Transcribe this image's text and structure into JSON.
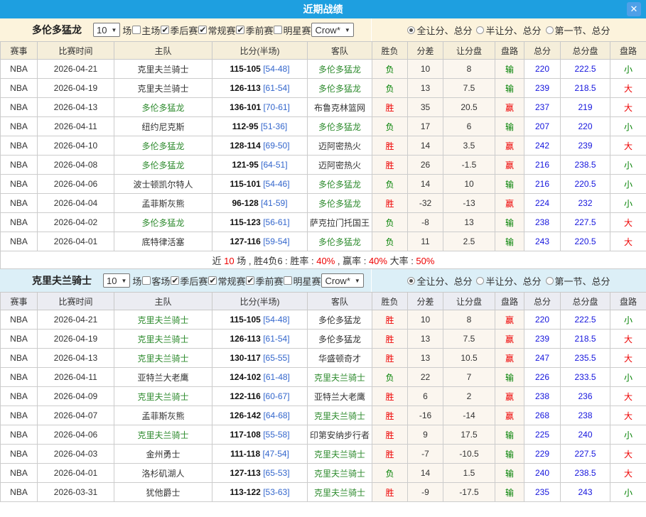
{
  "titlebar": {
    "title": "近期战绩"
  },
  "icons": {
    "close": "✕",
    "dropdown_arrow": "▼",
    "check": "✔"
  },
  "palette": {
    "titlebar_bg": "#1e9fe0",
    "close_bg": "#4fa0e8",
    "section1_bar_bg": "#fcf3dc",
    "section1_header_bg": "#f5eeda",
    "section2_bar_bg": "#dceff7",
    "section2_header_bg": "#ebecf2",
    "team_highlight_green": "#2e8b2e",
    "win_red": "#ee0000",
    "loss_green": "#008000",
    "total_blue": "#1515dd",
    "half_score_blue": "#3366cc"
  },
  "table_headers": [
    "赛事",
    "比赛时间",
    "主队",
    "比分(半场)",
    "客队",
    "胜负",
    "分差",
    "让分盘",
    "盘路",
    "总分",
    "总分盘",
    "盘路"
  ],
  "radios": [
    {
      "key": "full-handicap-total",
      "label": "全让分、总分"
    },
    {
      "key": "half-handicap-total",
      "label": "半让分、总分"
    },
    {
      "key": "first-quarter-total",
      "label": "第一节、总分"
    }
  ],
  "sections": [
    {
      "team": "多伦多猛龙",
      "theme": "beige",
      "controls": {
        "games_select": "10",
        "games_suffix": "场",
        "checkboxes": [
          {
            "key": "home-games",
            "label": "主场",
            "checked": false
          },
          {
            "key": "playoffs",
            "label": "季后赛",
            "checked": true
          },
          {
            "key": "regular-season",
            "label": "常规赛",
            "checked": true
          },
          {
            "key": "preseason",
            "label": "季前赛",
            "checked": true
          },
          {
            "key": "allstar",
            "label": "明星赛",
            "checked": false
          }
        ],
        "type_select": "Crow*",
        "radio_selected": 0
      },
      "rows": [
        {
          "league": "NBA",
          "date": "2026-04-21",
          "home": "克里夫兰骑士",
          "home_hl": false,
          "score": "115-105",
          "half": "[54-48]",
          "away": "多伦多猛龙",
          "away_hl": true,
          "result": "负",
          "margin": "10",
          "line": "8",
          "cover": "输",
          "total": "220",
          "total_line": "222.5",
          "ou": "小"
        },
        {
          "league": "NBA",
          "date": "2026-04-19",
          "home": "克里夫兰骑士",
          "home_hl": false,
          "score": "126-113",
          "half": "[61-54]",
          "away": "多伦多猛龙",
          "away_hl": true,
          "result": "负",
          "margin": "13",
          "line": "7.5",
          "cover": "输",
          "total": "239",
          "total_line": "218.5",
          "ou": "大"
        },
        {
          "league": "NBA",
          "date": "2026-04-13",
          "home": "多伦多猛龙",
          "home_hl": true,
          "score": "136-101",
          "half": "[70-61]",
          "away": "布鲁克林篮网",
          "away_hl": false,
          "result": "胜",
          "margin": "35",
          "line": "20.5",
          "cover": "赢",
          "total": "237",
          "total_line": "219",
          "ou": "大"
        },
        {
          "league": "NBA",
          "date": "2026-04-11",
          "home": "纽约尼克斯",
          "home_hl": false,
          "score": "112-95",
          "half": "[51-36]",
          "away": "多伦多猛龙",
          "away_hl": true,
          "result": "负",
          "margin": "17",
          "line": "6",
          "cover": "输",
          "total": "207",
          "total_line": "220",
          "ou": "小"
        },
        {
          "league": "NBA",
          "date": "2026-04-10",
          "home": "多伦多猛龙",
          "home_hl": true,
          "score": "128-114",
          "half": "[69-50]",
          "away": "迈阿密热火",
          "away_hl": false,
          "result": "胜",
          "margin": "14",
          "line": "3.5",
          "cover": "赢",
          "total": "242",
          "total_line": "239",
          "ou": "大"
        },
        {
          "league": "NBA",
          "date": "2026-04-08",
          "home": "多伦多猛龙",
          "home_hl": true,
          "score": "121-95",
          "half": "[64-51]",
          "away": "迈阿密热火",
          "away_hl": false,
          "result": "胜",
          "margin": "26",
          "line": "-1.5",
          "cover": "赢",
          "total": "216",
          "total_line": "238.5",
          "ou": "小"
        },
        {
          "league": "NBA",
          "date": "2026-04-06",
          "home": "波士顿凯尔特人",
          "home_hl": false,
          "score": "115-101",
          "half": "[54-46]",
          "away": "多伦多猛龙",
          "away_hl": true,
          "result": "负",
          "margin": "14",
          "line": "10",
          "cover": "输",
          "total": "216",
          "total_line": "220.5",
          "ou": "小"
        },
        {
          "league": "NBA",
          "date": "2026-04-04",
          "home": "孟菲斯灰熊",
          "home_hl": false,
          "score": "96-128",
          "half": "[41-59]",
          "away": "多伦多猛龙",
          "away_hl": true,
          "result": "胜",
          "margin": "-32",
          "line": "-13",
          "cover": "赢",
          "total": "224",
          "total_line": "232",
          "ou": "小"
        },
        {
          "league": "NBA",
          "date": "2026-04-02",
          "home": "多伦多猛龙",
          "home_hl": true,
          "score": "115-123",
          "half": "[56-61]",
          "away": "萨克拉门托国王",
          "away_hl": false,
          "result": "负",
          "margin": "-8",
          "line": "13",
          "cover": "输",
          "total": "238",
          "total_line": "227.5",
          "ou": "大"
        },
        {
          "league": "NBA",
          "date": "2026-04-01",
          "home": "底特律活塞",
          "home_hl": false,
          "score": "127-116",
          "half": "[59-54]",
          "away": "多伦多猛龙",
          "away_hl": true,
          "result": "负",
          "margin": "11",
          "line": "2.5",
          "cover": "输",
          "total": "243",
          "total_line": "220.5",
          "ou": "大"
        }
      ],
      "summary": [
        {
          "t": "近 ",
          "red": false
        },
        {
          "t": "10",
          "red": true
        },
        {
          "t": " 场 , 胜4负6 : 胜率 : ",
          "red": false
        },
        {
          "t": "40%",
          "red": true
        },
        {
          "t": " , 赢率 : ",
          "red": false
        },
        {
          "t": "40%",
          "red": true
        },
        {
          "t": " 大率 : ",
          "red": false
        },
        {
          "t": "50%",
          "red": true
        }
      ]
    },
    {
      "team": "克里夫兰骑士",
      "theme": "blue",
      "controls": {
        "games_select": "10",
        "games_suffix": "场",
        "checkboxes": [
          {
            "key": "away-games",
            "label": "客场",
            "checked": false
          },
          {
            "key": "playoffs",
            "label": "季后赛",
            "checked": true
          },
          {
            "key": "regular-season",
            "label": "常规赛",
            "checked": true
          },
          {
            "key": "preseason",
            "label": "季前赛",
            "checked": true
          },
          {
            "key": "allstar",
            "label": "明星赛",
            "checked": false
          }
        ],
        "type_select": "Crow*",
        "radio_selected": 0
      },
      "rows": [
        {
          "league": "NBA",
          "date": "2026-04-21",
          "home": "克里夫兰骑士",
          "home_hl": true,
          "score": "115-105",
          "half": "[54-48]",
          "away": "多伦多猛龙",
          "away_hl": false,
          "result": "胜",
          "margin": "10",
          "line": "8",
          "cover": "赢",
          "total": "220",
          "total_line": "222.5",
          "ou": "小"
        },
        {
          "league": "NBA",
          "date": "2026-04-19",
          "home": "克里夫兰骑士",
          "home_hl": true,
          "score": "126-113",
          "half": "[61-54]",
          "away": "多伦多猛龙",
          "away_hl": false,
          "result": "胜",
          "margin": "13",
          "line": "7.5",
          "cover": "赢",
          "total": "239",
          "total_line": "218.5",
          "ou": "大"
        },
        {
          "league": "NBA",
          "date": "2026-04-13",
          "home": "克里夫兰骑士",
          "home_hl": true,
          "score": "130-117",
          "half": "[65-55]",
          "away": "华盛顿奇才",
          "away_hl": false,
          "result": "胜",
          "margin": "13",
          "line": "10.5",
          "cover": "赢",
          "total": "247",
          "total_line": "235.5",
          "ou": "大"
        },
        {
          "league": "NBA",
          "date": "2026-04-11",
          "home": "亚特兰大老鹰",
          "home_hl": false,
          "score": "124-102",
          "half": "[61-48]",
          "away": "克里夫兰骑士",
          "away_hl": true,
          "result": "负",
          "margin": "22",
          "line": "7",
          "cover": "输",
          "total": "226",
          "total_line": "233.5",
          "ou": "小"
        },
        {
          "league": "NBA",
          "date": "2026-04-09",
          "home": "克里夫兰骑士",
          "home_hl": true,
          "score": "122-116",
          "half": "[60-67]",
          "away": "亚特兰大老鹰",
          "away_hl": false,
          "result": "胜",
          "margin": "6",
          "line": "2",
          "cover": "赢",
          "total": "238",
          "total_line": "236",
          "ou": "大"
        },
        {
          "league": "NBA",
          "date": "2026-04-07",
          "home": "孟菲斯灰熊",
          "home_hl": false,
          "score": "126-142",
          "half": "[64-68]",
          "away": "克里夫兰骑士",
          "away_hl": true,
          "result": "胜",
          "margin": "-16",
          "line": "-14",
          "cover": "赢",
          "total": "268",
          "total_line": "238",
          "ou": "大"
        },
        {
          "league": "NBA",
          "date": "2026-04-06",
          "home": "克里夫兰骑士",
          "home_hl": true,
          "score": "117-108",
          "half": "[55-58]",
          "away": "印第安纳步行者",
          "away_hl": false,
          "result": "胜",
          "margin": "9",
          "line": "17.5",
          "cover": "输",
          "total": "225",
          "total_line": "240",
          "ou": "小"
        },
        {
          "league": "NBA",
          "date": "2026-04-03",
          "home": "金州勇士",
          "home_hl": false,
          "score": "111-118",
          "half": "[47-54]",
          "away": "克里夫兰骑士",
          "away_hl": true,
          "result": "胜",
          "margin": "-7",
          "line": "-10.5",
          "cover": "输",
          "total": "229",
          "total_line": "227.5",
          "ou": "大"
        },
        {
          "league": "NBA",
          "date": "2026-04-01",
          "home": "洛杉矶湖人",
          "home_hl": false,
          "score": "127-113",
          "half": "[65-53]",
          "away": "克里夫兰骑士",
          "away_hl": true,
          "result": "负",
          "margin": "14",
          "line": "1.5",
          "cover": "输",
          "total": "240",
          "total_line": "238.5",
          "ou": "大"
        },
        {
          "league": "NBA",
          "date": "2026-03-31",
          "home": "犹他爵士",
          "home_hl": false,
          "score": "113-122",
          "half": "[53-63]",
          "away": "克里夫兰骑士",
          "away_hl": true,
          "result": "胜",
          "margin": "-9",
          "line": "-17.5",
          "cover": "输",
          "total": "235",
          "total_line": "243",
          "ou": "小"
        }
      ]
    }
  ]
}
